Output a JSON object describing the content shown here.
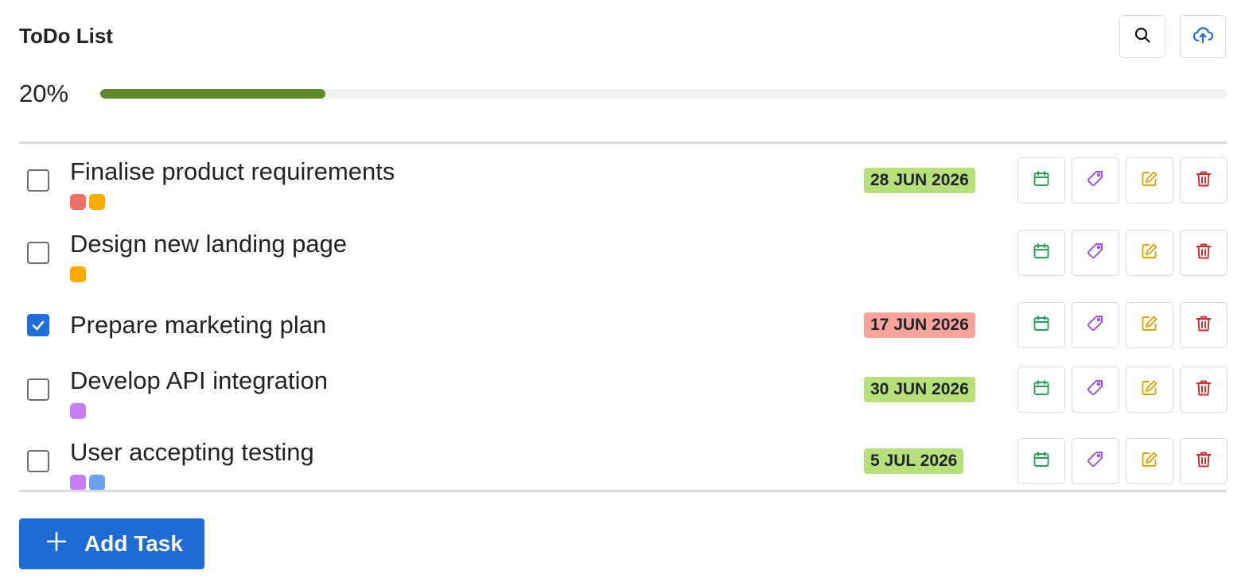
{
  "header": {
    "title": "ToDo List",
    "search_icon": "search-icon",
    "upload_icon": "cloud-upload-icon"
  },
  "progress": {
    "label": "20%",
    "value": 0.2,
    "color": "#5e8a2a"
  },
  "tasks": [
    {
      "title": "Finalise product requirements",
      "checked": false,
      "tags": [
        "#f07167",
        "#ffaa00"
      ],
      "date": "28 JUN 2026",
      "date_color": "#b7e07a"
    },
    {
      "title": "Design new landing page",
      "checked": false,
      "tags": [
        "#ffaa00"
      ],
      "date": "",
      "date_color": ""
    },
    {
      "title": "Prepare marketing plan",
      "checked": true,
      "tags": [],
      "date": "17 JUN 2026",
      "date_color": "#f8a39a"
    },
    {
      "title": "Develop API integration",
      "checked": false,
      "tags": [
        "#c77df3"
      ],
      "date": "30 JUN 2026",
      "date_color": "#b7e07a"
    },
    {
      "title": "User accepting testing",
      "checked": false,
      "tags": [
        "#c77df3",
        "#6ea0f0"
      ],
      "date": "5 JUL 2026",
      "date_color": "#b7e07a"
    }
  ],
  "actions": [
    {
      "icon": "calendar-icon",
      "color": "#2e9d5c"
    },
    {
      "icon": "tag-icon",
      "color": "#a04ae0"
    },
    {
      "icon": "edit-icon",
      "color": "#d9a50a"
    },
    {
      "icon": "trash-icon",
      "color": "#cc2a2a"
    }
  ],
  "add_button": {
    "label": "Add Task",
    "icon": "plus-icon",
    "color": "#1e6bd6"
  }
}
